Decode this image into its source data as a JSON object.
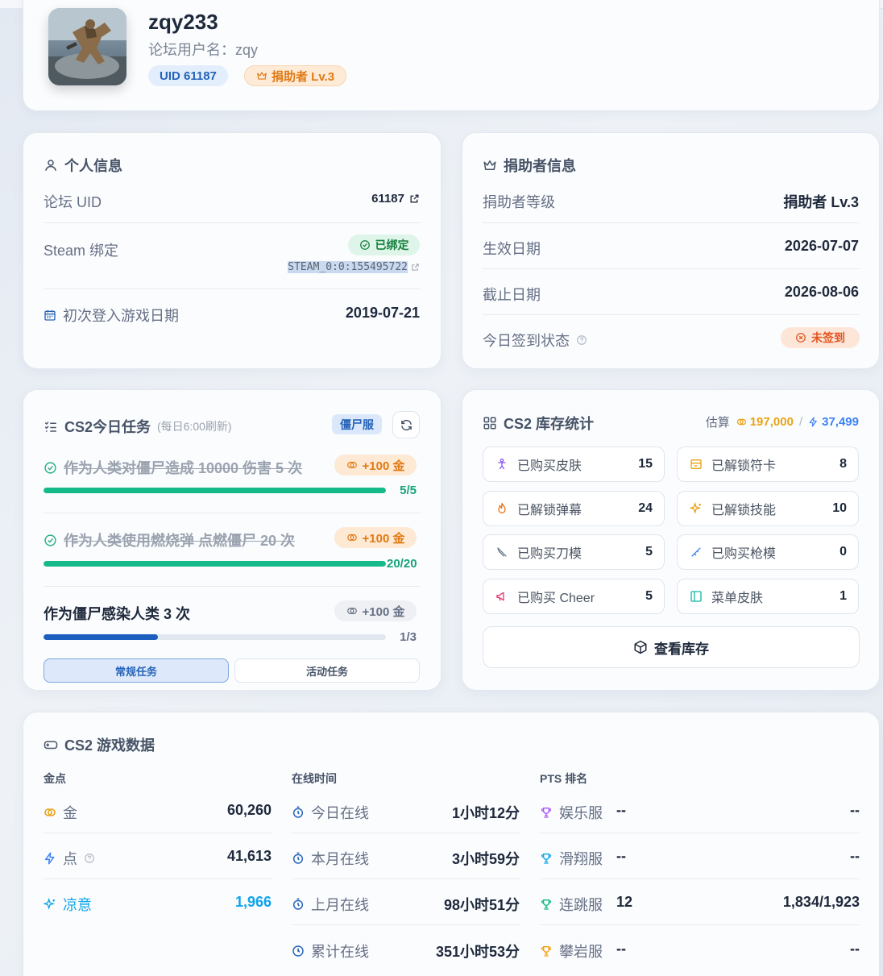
{
  "profile": {
    "username": "zqy233",
    "forum_name": "论坛用户名：zqy",
    "uid_badge": "UID 61187",
    "donor_badge": "捐助者 Lv.3"
  },
  "personal": {
    "title": "个人信息",
    "forum_uid_label": "论坛 UID",
    "forum_uid_value": "61187",
    "steam_label": "Steam 绑定",
    "steam_status": "已绑定",
    "steam_id": "STEAM_0:0:155495722",
    "first_login_label": "初次登入游戏日期",
    "first_login_value": "2019-07-21"
  },
  "donor": {
    "title": "捐助者信息",
    "level_label": "捐助者等级",
    "level_value": "捐助者 Lv.3",
    "start_label": "生效日期",
    "start_value": "2026-07-07",
    "end_label": "截止日期",
    "end_value": "2026-08-06",
    "checkin_label": "今日签到状态",
    "checkin_value": "未签到"
  },
  "tasks": {
    "title": "CS2今日任务",
    "subtitle": "(每日6:00刷新)",
    "server_tag": "僵尸服",
    "items": [
      {
        "text": "作为人类对僵尸造成 10000 伤害 5 次",
        "reward": "+100 金",
        "progress_text": "5/5",
        "progress": 1.0,
        "done": true
      },
      {
        "text": "作为人类使用燃烧弹 点燃僵尸 20 次",
        "reward": "+100 金",
        "progress_text": "20/20",
        "progress": 1.0,
        "done": true
      },
      {
        "text": "作为僵尸感染人类 3 次",
        "reward": "+100 金",
        "progress_text": "1/3",
        "progress": 0.333,
        "done": false
      }
    ],
    "tab_regular": "常规任务",
    "tab_event": "活动任务"
  },
  "inventory": {
    "title": "CS2 库存统计",
    "estimate_label": "估算",
    "estimate_gold": "197,000",
    "estimate_sep": "/",
    "estimate_points": "37,499",
    "items": [
      {
        "label": "已购买皮肤",
        "count": "15",
        "icon": "person-icon"
      },
      {
        "label": "已解锁符卡",
        "count": "8",
        "icon": "card-icon"
      },
      {
        "label": "已解锁弹幕",
        "count": "24",
        "icon": "flame-icon"
      },
      {
        "label": "已解锁技能",
        "count": "10",
        "icon": "sparkle-icon"
      },
      {
        "label": "已购买刀模",
        "count": "5",
        "icon": "knife-icon"
      },
      {
        "label": "已购买枪模",
        "count": "0",
        "icon": "gun-icon"
      },
      {
        "label": "已购买 Cheer",
        "count": "5",
        "icon": "megaphone-icon"
      },
      {
        "label": "菜单皮肤",
        "count": "1",
        "icon": "panel-icon"
      }
    ],
    "view_button": "查看库存"
  },
  "game": {
    "title": "CS2 游戏数据",
    "col_gold_head": "金点",
    "col_time_head": "在线时间",
    "col_pts_head": "PTS 排名",
    "gold_rows": [
      {
        "label": "金",
        "value": "60,260"
      },
      {
        "label": "点",
        "value": "41,613"
      },
      {
        "label": "凉意",
        "value": "1,966"
      }
    ],
    "time_rows": [
      {
        "label": "今日在线",
        "value": "1小时12分"
      },
      {
        "label": "本月在线",
        "value": "3小时59分"
      },
      {
        "label": "上月在线",
        "value": "98小时51分"
      },
      {
        "label": "累计在线",
        "value": "351小时53分"
      }
    ],
    "pts_rows": [
      {
        "label": "娱乐服",
        "rank": "--",
        "score": "--"
      },
      {
        "label": "滑翔服",
        "rank": "--",
        "score": "--"
      },
      {
        "label": "连跳服",
        "rank": "12",
        "score": "1,834/1,923"
      },
      {
        "label": "攀岩服",
        "rank": "--",
        "score": "--"
      }
    ]
  }
}
